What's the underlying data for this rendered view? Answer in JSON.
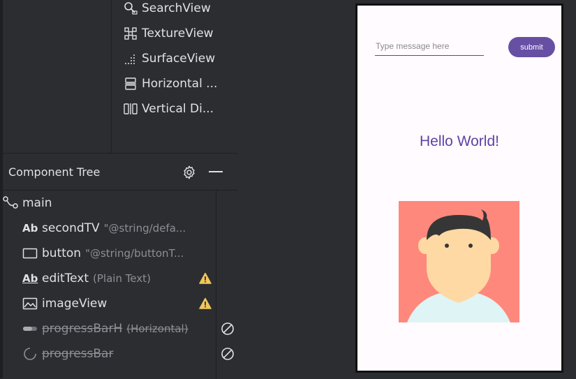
{
  "palette": {
    "items": [
      {
        "label": "SearchView",
        "icon": "search-view-icon"
      },
      {
        "label": "TextureView",
        "icon": "texture-view-icon"
      },
      {
        "label": "SurfaceView",
        "icon": "surface-view-icon"
      },
      {
        "label": "Horizontal ...",
        "icon": "horizontal-divider-icon"
      },
      {
        "label": "Vertical Di...",
        "icon": "vertical-divider-icon"
      }
    ]
  },
  "component_tree": {
    "title": "Component Tree",
    "rows": [
      {
        "name": "main",
        "sub": "",
        "icon": "constraint-layout-icon"
      },
      {
        "name": "secondTV",
        "sub": "\"@string/defa...",
        "icon": "textview-icon",
        "icon_text": "Ab"
      },
      {
        "name": "button",
        "sub": "\"@string/buttonT...",
        "icon": "button-icon"
      },
      {
        "name": "editText",
        "sub": "(Plain Text)",
        "icon": "edittext-icon",
        "icon_text": "Ab",
        "status": "warning"
      },
      {
        "name": "imageView",
        "sub": "",
        "icon": "imageview-icon",
        "status": "warning"
      },
      {
        "name": "progressBarH",
        "sub": "(Horizontal)",
        "icon": "progressbar-horizontal-icon",
        "status": "disabled"
      },
      {
        "name": "progressBar",
        "sub": "",
        "icon": "progressbar-icon",
        "status": "disabled"
      }
    ]
  },
  "preview": {
    "edit_placeholder": "Type message here",
    "submit_label": "submit",
    "hello_text": "Hello World!",
    "colors": {
      "button": "#6750a4",
      "hello": "#6140a8",
      "avatar_bg": "#fe887c",
      "background": "#fffbfe"
    }
  }
}
